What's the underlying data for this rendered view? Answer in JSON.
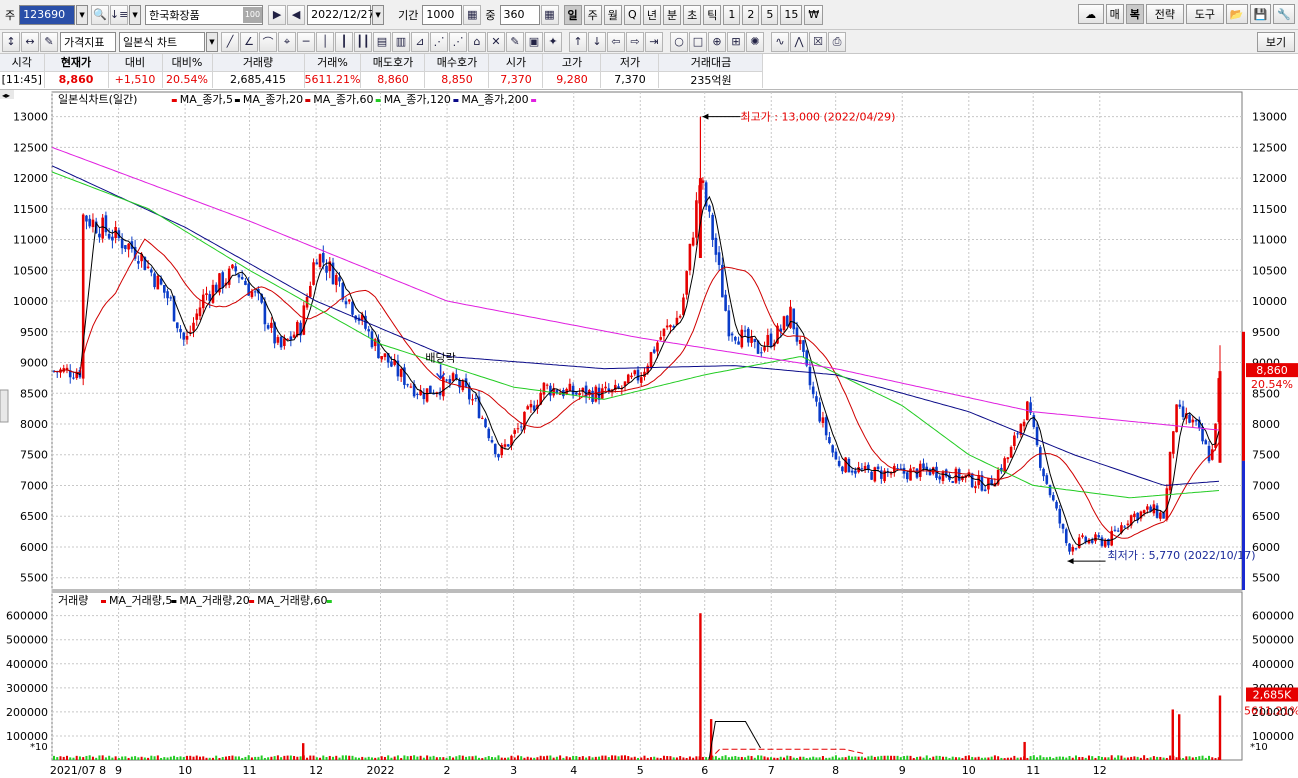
{
  "toolbar": {
    "market_label": "주",
    "code": "123690",
    "name": "한국화장품",
    "name_badge": "100",
    "date": "2022/12/27",
    "period_label": "기간",
    "period_value": "1000",
    "mid_label": "중",
    "count": "360",
    "periods": [
      "일",
      "주",
      "월",
      "Q",
      "년",
      "분",
      "초",
      "틱",
      "1",
      "2",
      "5",
      "15",
      "₩"
    ],
    "active_period": "일",
    "right_buttons": [
      "매",
      "복",
      "전략",
      "도구"
    ],
    "indicator_select": "가격지표",
    "chart_type_select": "일본식 차트",
    "view_button": "보기"
  },
  "quote": {
    "headers": [
      "시각",
      "현재가",
      "대비",
      "대비%",
      "거래량",
      "거래%",
      "매도호가",
      "매수호가",
      "시가",
      "고가",
      "저가",
      "거래대금"
    ],
    "values": [
      "[11:45]",
      "8,860",
      "+1,510",
      "20.54%",
      "2,685,415",
      "5611.21%",
      "8,860",
      "8,850",
      "7,370",
      "9,280",
      "7,370",
      "235억원"
    ]
  },
  "price_panel": {
    "title": "일본식차트(일간)",
    "legend": [
      {
        "label": "MA_종가,5",
        "color": "#e60000"
      },
      {
        "label": "MA_종가,20",
        "color": "#000000"
      },
      {
        "label": "MA_종가,60",
        "color": "#d00000"
      },
      {
        "label": "MA_종가,120",
        "color": "#22cc22"
      },
      {
        "label": "MA_종가,200",
        "color": "#0a0a88"
      }
    ],
    "legend_tail_color": "#e020e0",
    "high_note": "최고가 : 13,000 (2022/04/29)",
    "low_note": "최저가 : 5,770 (2022/10/17)",
    "event_note": "배당락",
    "last_price_tag": "8,860",
    "last_pct_tag": "20.54%"
  },
  "volume_panel": {
    "title": "거래량",
    "legend": [
      {
        "label": "MA_거래량,5",
        "color": "#e60000"
      },
      {
        "label": "MA_거래량,20",
        "color": "#000000"
      },
      {
        "label": "MA_거래량,60",
        "color": "#e60000"
      }
    ],
    "legend_tail_color": "#22cc22",
    "last_volume_tag": "2,685K",
    "last_pct_tag": "5611.21%",
    "unit_left": "*10",
    "unit_right": "*10"
  },
  "chart_data": {
    "type": "candlestick",
    "x_labels": [
      "2021/07 8",
      "9",
      "10",
      "11",
      "12",
      "2022",
      "2",
      "3",
      "4",
      "5",
      "6",
      "7",
      "8",
      "9",
      "10",
      "11",
      "12"
    ],
    "price_ylim": [
      5300,
      13400
    ],
    "price_ticks": [
      5500,
      6000,
      6500,
      7000,
      7500,
      8000,
      8500,
      9000,
      9500,
      10000,
      10500,
      11000,
      11500,
      12000,
      12500,
      13000
    ],
    "volume_ylim": [
      0,
      640000
    ],
    "volume_ticks": [
      100000,
      200000,
      300000,
      400000,
      500000,
      600000
    ],
    "close_series": [
      [
        "2021-07-15",
        11400
      ],
      [
        "2021-08-10",
        10800
      ],
      [
        "2021-08-25",
        10000
      ],
      [
        "2021-09-01",
        9300
      ],
      [
        "2021-09-10",
        10100
      ],
      [
        "2021-09-25",
        10500
      ],
      [
        "2021-10-05",
        10000
      ],
      [
        "2021-10-15",
        9200
      ],
      [
        "2021-10-25",
        9600
      ],
      [
        "2021-11-01",
        10800
      ],
      [
        "2021-11-10",
        10400
      ],
      [
        "2021-11-20",
        9800
      ],
      [
        "2021-11-30",
        9200
      ],
      [
        "2021-12-10",
        8800
      ],
      [
        "2021-12-20",
        8500
      ],
      [
        "2022-01-05",
        8700
      ],
      [
        "2022-01-15",
        8300
      ],
      [
        "2022-01-25",
        7500
      ],
      [
        "2022-02-05",
        8000
      ],
      [
        "2022-02-15",
        8600
      ],
      [
        "2022-03-01",
        8500
      ],
      [
        "2022-03-20",
        8500
      ],
      [
        "2022-04-01",
        8800
      ],
      [
        "2022-04-10",
        9400
      ],
      [
        "2022-04-20",
        9800
      ],
      [
        "2022-04-29",
        12000
      ],
      [
        "2022-05-05",
        11000
      ],
      [
        "2022-05-12",
        9600
      ],
      [
        "2022-05-25",
        9200
      ],
      [
        "2022-06-05",
        9500
      ],
      [
        "2022-06-10",
        9800
      ],
      [
        "2022-06-20",
        8500
      ],
      [
        "2022-07-01",
        7400
      ],
      [
        "2022-07-15",
        7200
      ],
      [
        "2022-08-01",
        7200
      ],
      [
        "2022-08-15",
        7250
      ],
      [
        "2022-09-01",
        7100
      ],
      [
        "2022-09-10",
        7000
      ],
      [
        "2022-09-20",
        7500
      ],
      [
        "2022-09-28",
        8300
      ],
      [
        "2022-10-05",
        7300
      ],
      [
        "2022-10-17",
        6000
      ],
      [
        "2022-10-25",
        6100
      ],
      [
        "2022-11-05",
        6100
      ],
      [
        "2022-11-15",
        6500
      ],
      [
        "2022-11-25",
        6600
      ],
      [
        "2022-12-01",
        6500
      ],
      [
        "2022-12-06",
        8200
      ],
      [
        "2022-12-15",
        8000
      ],
      [
        "2022-12-23",
        7400
      ],
      [
        "2022-12-27",
        8860
      ]
    ],
    "ma200": [
      [
        "2021-07-01",
        12500
      ],
      [
        "2021-10-01",
        11300
      ],
      [
        "2022-01-01",
        10000
      ],
      [
        "2022-04-01",
        9400
      ],
      [
        "2022-07-01",
        8900
      ],
      [
        "2022-10-01",
        8200
      ],
      [
        "2022-12-27",
        7900
      ]
    ],
    "ma120": [
      [
        "2021-07-01",
        12100
      ],
      [
        "2021-08-15",
        11500
      ],
      [
        "2021-10-01",
        10500
      ],
      [
        "2021-12-01",
        9300
      ],
      [
        "2022-02-01",
        8600
      ],
      [
        "2022-03-15",
        8400
      ],
      [
        "2022-05-01",
        8800
      ],
      [
        "2022-06-15",
        9100
      ],
      [
        "2022-08-01",
        8300
      ],
      [
        "2022-09-01",
        7500
      ],
      [
        "2022-10-01",
        7000
      ],
      [
        "2022-11-15",
        6800
      ],
      [
        "2022-12-27",
        6920
      ]
    ],
    "ma60": [
      [
        "2021-07-01",
        12200
      ],
      [
        "2021-09-01",
        11200
      ],
      [
        "2021-11-01",
        10000
      ],
      [
        "2022-01-01",
        9100
      ],
      [
        "2022-03-15",
        8900
      ],
      [
        "2022-05-15",
        8950
      ],
      [
        "2022-07-01",
        8800
      ],
      [
        "2022-09-01",
        8200
      ],
      [
        "2022-10-20",
        7500
      ],
      [
        "2022-12-01",
        7000
      ],
      [
        "2022-12-27",
        7070
      ]
    ],
    "volume_spikes": [
      [
        "2022-04-29",
        610000
      ],
      [
        "2022-05-04",
        170000
      ],
      [
        "2021-10-26",
        70000
      ],
      [
        "2022-09-27",
        75000
      ],
      [
        "2022-12-05",
        210000
      ],
      [
        "2022-12-08",
        190000
      ],
      [
        "2022-12-27",
        268000
      ]
    ],
    "volume_ma20": [
      [
        "2022-05-03",
        0
      ],
      [
        "2022-05-06",
        160000
      ],
      [
        "2022-05-20",
        160000
      ],
      [
        "2022-05-27",
        50000
      ]
    ],
    "volume_ma60": [
      [
        "2022-05-03",
        0
      ],
      [
        "2022-05-08",
        45000
      ],
      [
        "2022-07-05",
        45000
      ],
      [
        "2022-07-15",
        25000
      ]
    ],
    "high": {
      "date": "2022-04-29",
      "value": 13000
    },
    "low": {
      "date": "2022-10-17",
      "value": 5770
    },
    "dividend_date": "2021-12-29"
  }
}
